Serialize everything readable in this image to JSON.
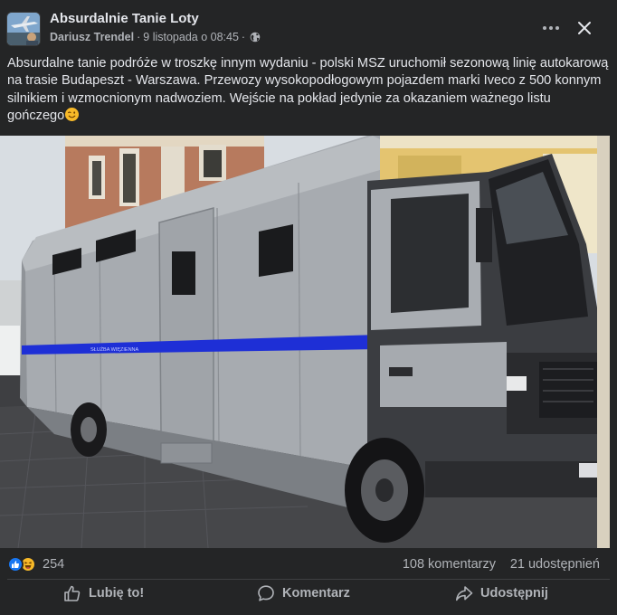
{
  "header": {
    "group_name": "Absurdalnie Tanie Loty",
    "author": "Dariusz Trendel",
    "separator": "·",
    "date": "9 listopada o 08:45",
    "separator2": "·",
    "privacy_icon": "globe-icon",
    "more_icon": "more-horizontal-icon",
    "close_icon": "close-icon"
  },
  "post": {
    "text": "Absurdalne tanie podróże w troszkę innym wydaniu - polski MSZ uruchomił sezonową linię autokarową na trasie Budapeszt - Warszawa. Przewozy wysokopodłogowym pojazdem marki Iveco z 500 konnym silnikiem i wzmocnionym nadwoziem. Wejście na pokład jedynie za okazaniem ważnego listu gończego",
    "trailing_emoji": "winking-face-emoji",
    "image": {
      "description_icon": "prison-transport-truck-photo",
      "vehicle_lettering": "SŁUŻBA WIĘZIENNA"
    }
  },
  "stats": {
    "reaction_icons": [
      "like-reaction-icon",
      "haha-reaction-icon"
    ],
    "reaction_count": "254",
    "comments": "108 komentarzy",
    "shares": "21 udostępnień"
  },
  "actions": {
    "like_label": "Lubię to!",
    "comment_label": "Komentarz",
    "share_label": "Udostępnij"
  },
  "colors": {
    "background": "#242526",
    "text_primary": "#e4e6eb",
    "text_secondary": "#b0b3b8",
    "like_blue": "#1877f2",
    "haha_yellow": "#f7b928",
    "stripe_blue": "#1e2fd6"
  }
}
